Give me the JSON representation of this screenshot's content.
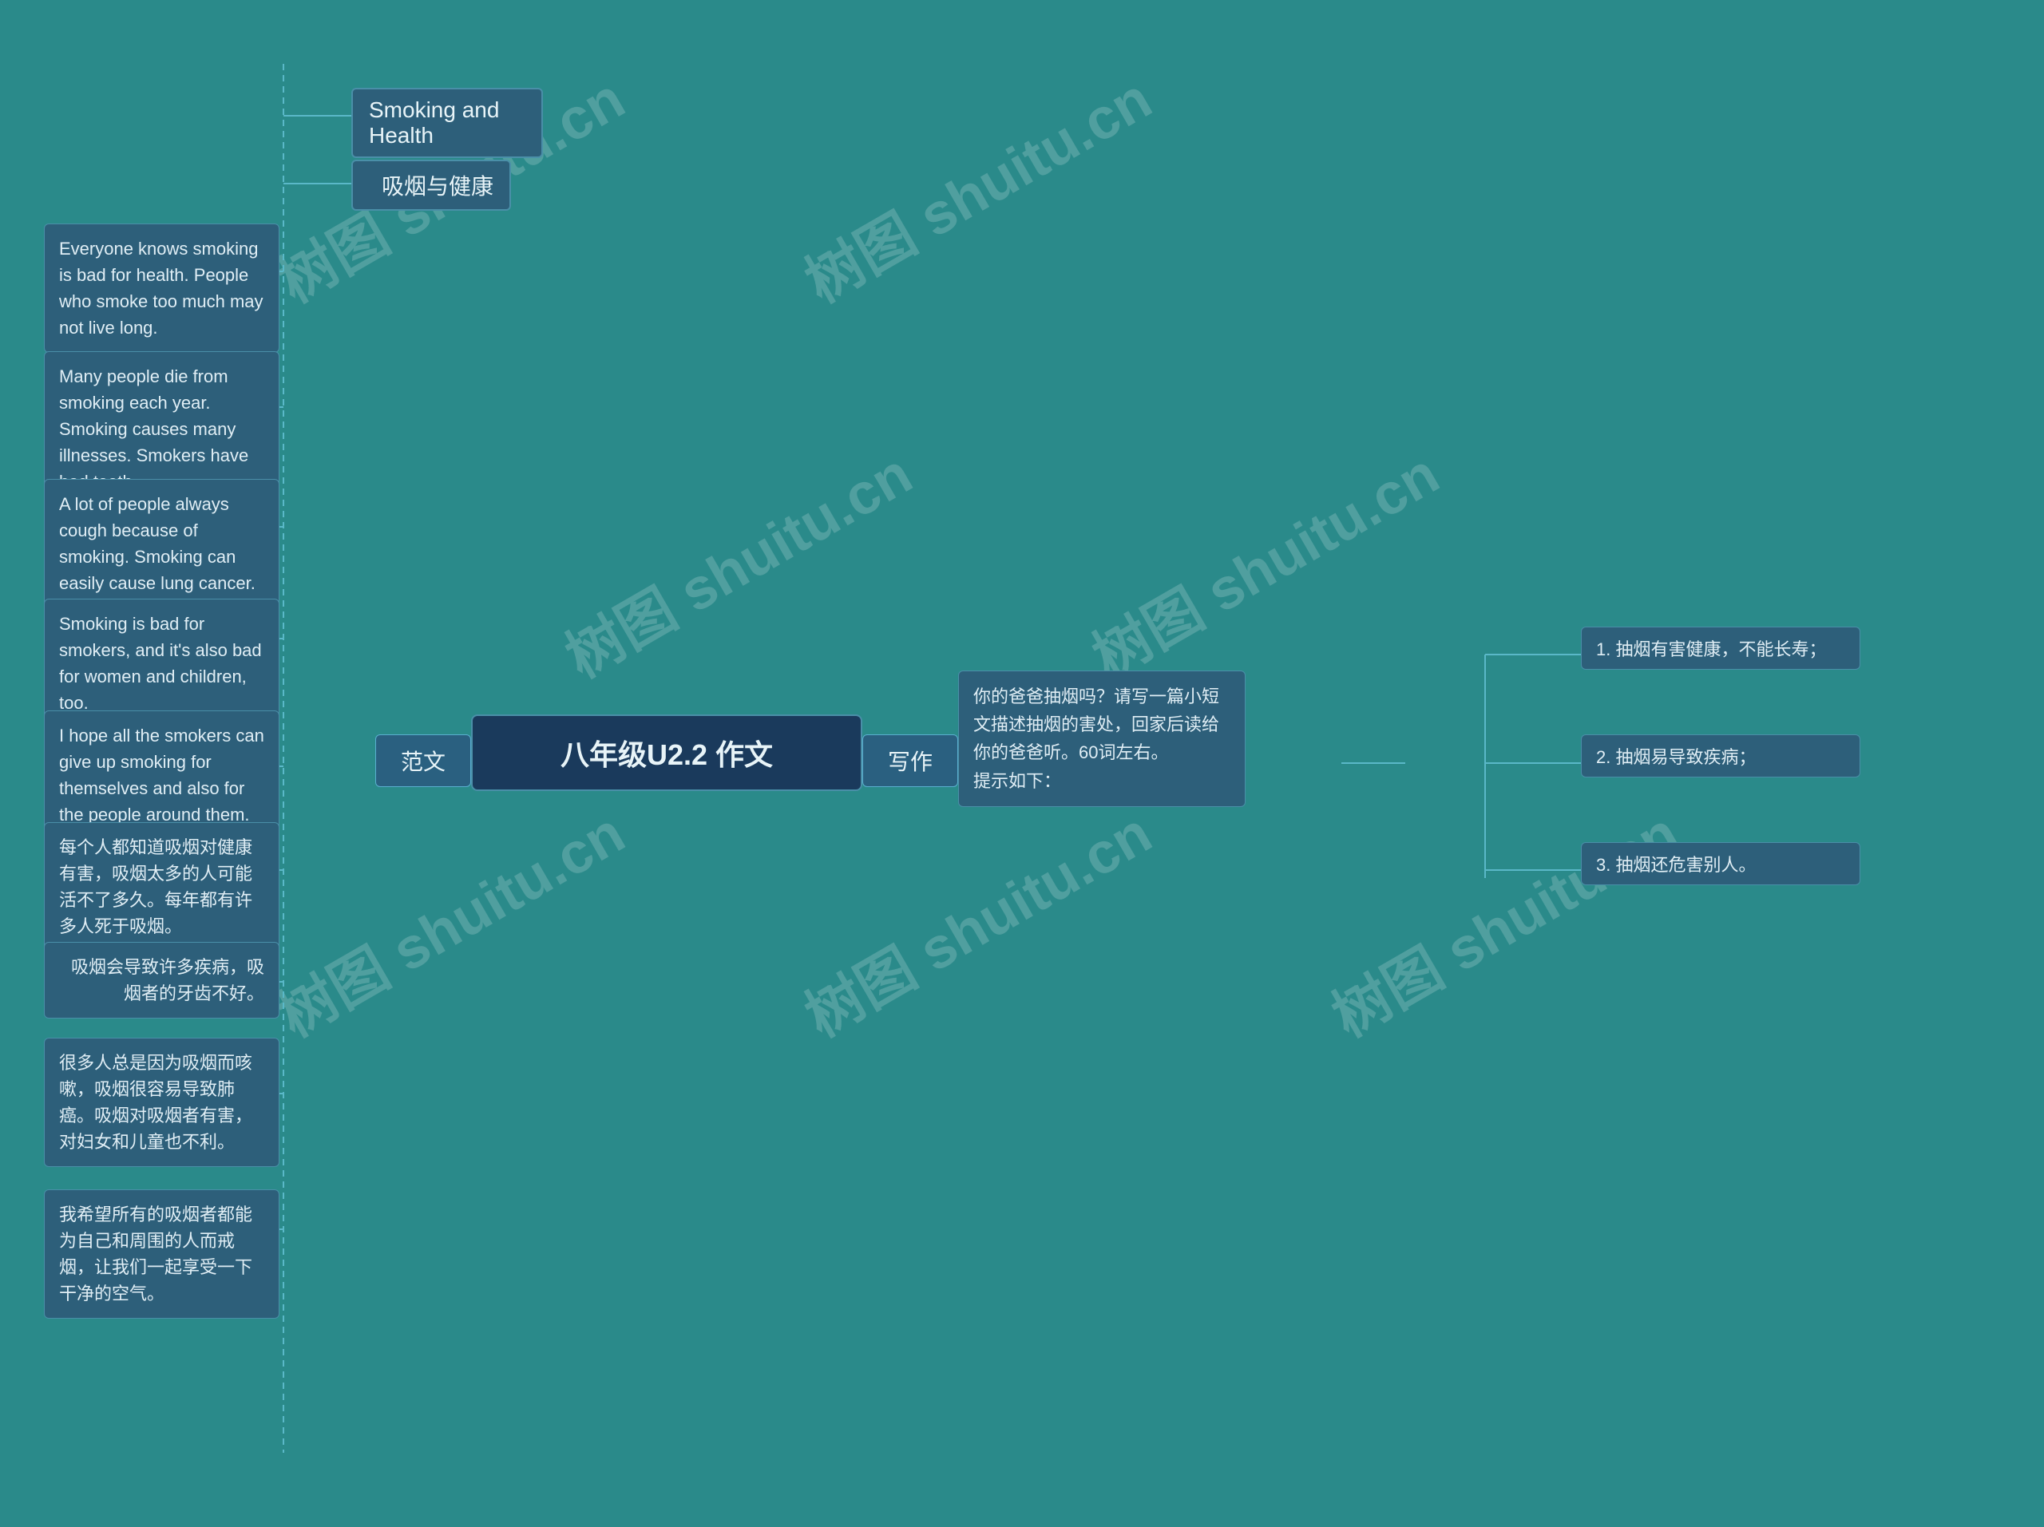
{
  "watermarks": [
    {
      "text": "树图 shuitu.cn",
      "class": "wm1"
    },
    {
      "text": "树图 shuitu.cn",
      "class": "wm2"
    },
    {
      "text": "树图 shuitu.cn",
      "class": "wm3"
    },
    {
      "text": "树图 shuitu.cn",
      "class": "wm4"
    },
    {
      "text": "树图 shuitu.cn",
      "class": "wm5"
    },
    {
      "text": "树图 shuitu.cn",
      "class": "wm6"
    },
    {
      "text": "树图 shuitu.cn",
      "class": "wm7"
    }
  ],
  "title_en": "Smoking and Health",
  "title_cn": "吸烟与健康",
  "main_node": "八年级U2.2 作文",
  "label_fanwen": "范文",
  "label_xiezuo": "写作",
  "paragraphs_en": [
    "Everyone knows smoking is bad for health. People who smoke too much may not live long.",
    "Many people die from smoking each year. Smoking causes many illnesses. Smokers have bad teeth.",
    "A lot of people always cough because of smoking. Smoking can easily cause lung cancer.",
    "Smoking is bad for smokers, and it's also bad for women and children, too.",
    "I hope all the smokers can give up smoking for themselves and also for the people around them. Let's enjoy clean air."
  ],
  "paragraphs_cn": [
    "每个人都知道吸烟对健康有害，吸烟太多的人可能活不了多久。每年都有许多人死于吸烟。",
    "吸烟会导致许多疾病，吸烟者的牙齿不好。",
    "很多人总是因为吸烟而咳嗽，吸烟很容易导致肺癌。吸烟对吸烟者有害，对妇女和儿童也不利。",
    "我希望所有的吸烟者都能为自己和周围的人而戒烟，让我们一起享受一下干净的空气。"
  ],
  "prompt": "你的爸爸抽烟吗？请写一篇小短文描述抽烟的害处，回家后读给你的爸爸听。60词左右。\n提示如下：",
  "hints": [
    "1. 抽烟有害健康，不能长寿；",
    "2. 抽烟易导致疾病；",
    "3. 抽烟还危害别人。"
  ]
}
